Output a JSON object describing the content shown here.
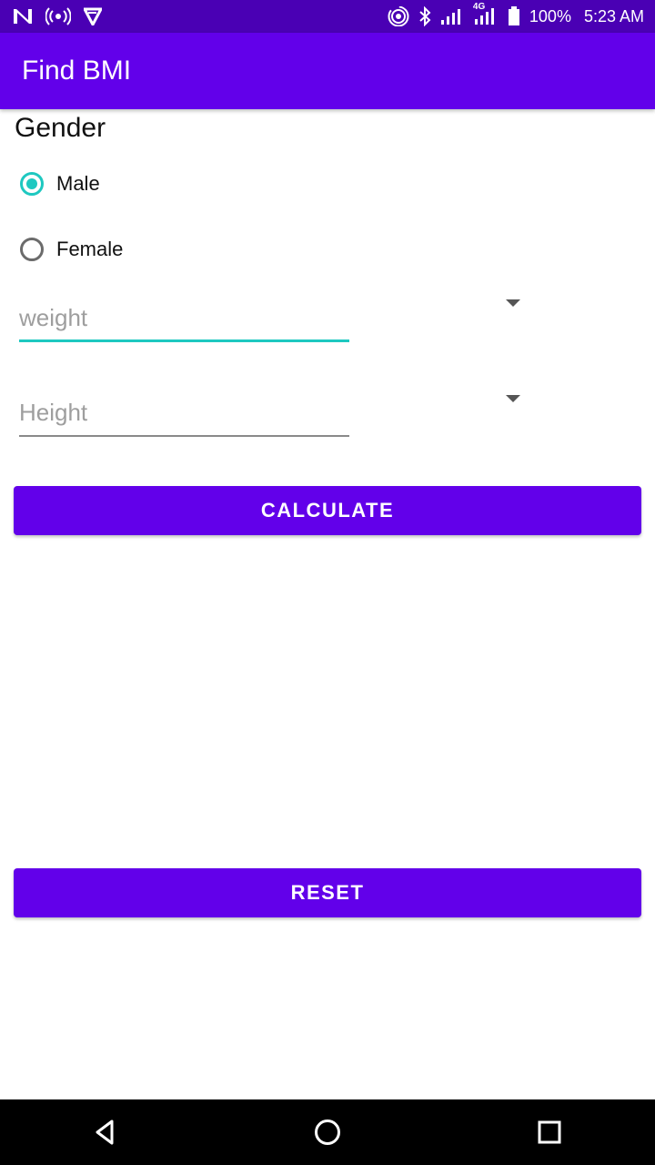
{
  "status_bar": {
    "battery_percent": "100%",
    "time": "5:23 AM",
    "network_type": "4G",
    "icons_left": [
      "n-logo-icon",
      "hotspot-icon",
      "play-store-icon"
    ],
    "icons_right": [
      "wireless-icon",
      "bluetooth-icon",
      "signal-icon",
      "signal-4g-icon",
      "battery-icon"
    ]
  },
  "app_bar": {
    "title": "Find BMI"
  },
  "form": {
    "gender_label": "Gender",
    "options": [
      {
        "label": "Male",
        "checked": true
      },
      {
        "label": "Female",
        "checked": false
      }
    ],
    "weight": {
      "placeholder": "weight",
      "value": ""
    },
    "height": {
      "placeholder": "Height",
      "value": ""
    }
  },
  "buttons": {
    "calculate": "CALCULATE",
    "reset": "RESET"
  },
  "colors": {
    "primary": "#6200ea",
    "status_bar": "#4a00b4",
    "accent": "#1ec8c0"
  },
  "nav_bar": {
    "buttons": [
      "back-icon",
      "home-icon",
      "recents-icon"
    ]
  }
}
